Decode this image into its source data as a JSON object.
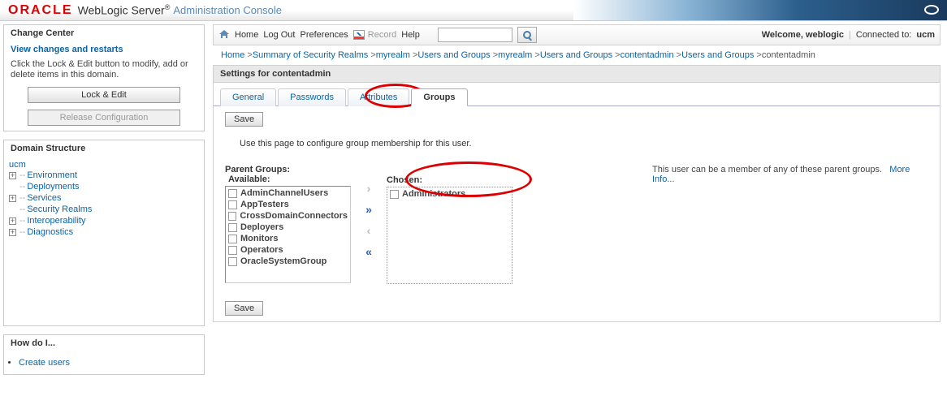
{
  "header": {
    "brand": "ORACLE",
    "product": "WebLogic Server",
    "subtitle": "Administration Console"
  },
  "change_center": {
    "title": "Change Center",
    "view_link": "View changes and restarts",
    "instruction": "Click the Lock & Edit button to modify, add or delete items in this domain.",
    "lock_btn": "Lock & Edit",
    "release_btn": "Release Configuration"
  },
  "domain_structure": {
    "title": "Domain Structure",
    "root": "ucm",
    "items": [
      {
        "label": "Environment",
        "expandable": true
      },
      {
        "label": "Deployments",
        "expandable": false
      },
      {
        "label": "Services",
        "expandable": true
      },
      {
        "label": "Security Realms",
        "expandable": false
      },
      {
        "label": "Interoperability",
        "expandable": true
      },
      {
        "label": "Diagnostics",
        "expandable": true
      }
    ]
  },
  "how_do_i": {
    "title": "How do I...",
    "items": [
      "Create users"
    ]
  },
  "topbar": {
    "home": "Home",
    "logout": "Log Out",
    "preferences": "Preferences",
    "record": "Record",
    "help": "Help",
    "search_placeholder": "",
    "welcome": "Welcome, weblogic",
    "connected_label": "Connected to:",
    "connected_value": "ucm"
  },
  "breadcrumb": [
    {
      "label": "Home",
      "link": true
    },
    {
      "label": "Summary of Security Realms",
      "link": true
    },
    {
      "label": "myrealm",
      "link": true
    },
    {
      "label": "Users and Groups",
      "link": true
    },
    {
      "label": "myrealm",
      "link": true
    },
    {
      "label": "Users and Groups",
      "link": true
    },
    {
      "label": "contentadmin",
      "link": true
    },
    {
      "label": "Users and Groups",
      "link": true
    },
    {
      "label": "contentadmin",
      "link": false
    }
  ],
  "settings": {
    "title": "Settings for contentadmin",
    "tabs": [
      "General",
      "Passwords",
      "Attributes",
      "Groups"
    ],
    "active_tab": "Groups",
    "save": "Save",
    "description": "Use this page to configure group membership for this user.",
    "parent_label": "Parent Groups:",
    "available_label": "Available:",
    "chosen_label": "Chosen:",
    "available": [
      "AdminChannelUsers",
      "AppTesters",
      "CrossDomainConnectors",
      "Deployers",
      "Monitors",
      "Operators",
      "OracleSystemGroup"
    ],
    "chosen": [
      "Administrators"
    ],
    "help_text": "This user can be a member of any of these parent groups.",
    "more_info": "More Info..."
  }
}
